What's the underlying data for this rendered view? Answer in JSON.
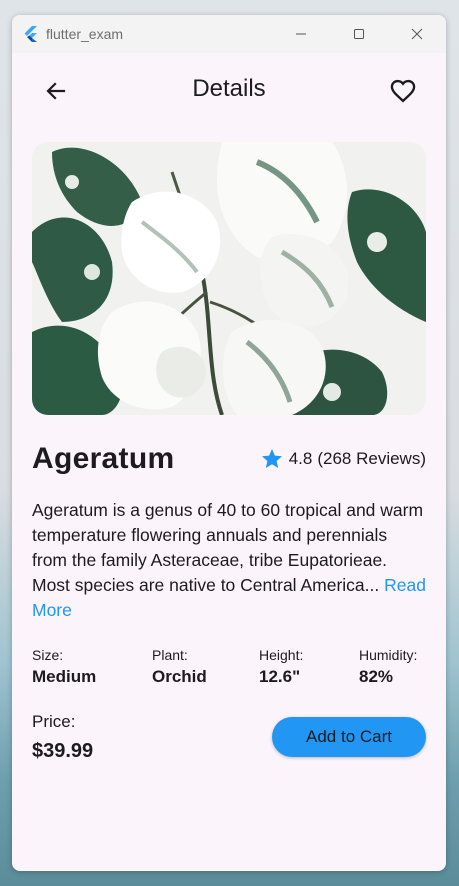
{
  "window": {
    "title": "flutter_exam",
    "app_icon": "flutter-logo-icon",
    "controls": [
      "minimize-icon",
      "maximize-icon",
      "close-icon"
    ]
  },
  "appbar": {
    "title": "Details",
    "back_icon": "arrow-back-icon",
    "favorite_icon": "heart-outline-icon"
  },
  "product": {
    "image_icon": "plant-photo",
    "name": "Ageratum",
    "rating": "4.8",
    "reviews": "(268 Reviews)",
    "description": "Ageratum is a genus of 40 to 60 tropical and warm temperature flowering annuals and perennials from the family Asteraceae, tribe Eupatorieae. Most species are native to Central America...",
    "read_more": "Read More"
  },
  "specs": [
    {
      "label": "Size:",
      "value": "Medium"
    },
    {
      "label": "Plant:",
      "value": "Orchid"
    },
    {
      "label": "Height:",
      "value": "12.6\""
    },
    {
      "label": "Humidity:",
      "value": "82%"
    }
  ],
  "price": {
    "label": "Price:",
    "value": "$39.99"
  },
  "cart": {
    "label": "Add to Cart"
  },
  "colors": {
    "accent": "#2196f3",
    "background": "#fcf4fb",
    "text": "#1c1b1f"
  }
}
